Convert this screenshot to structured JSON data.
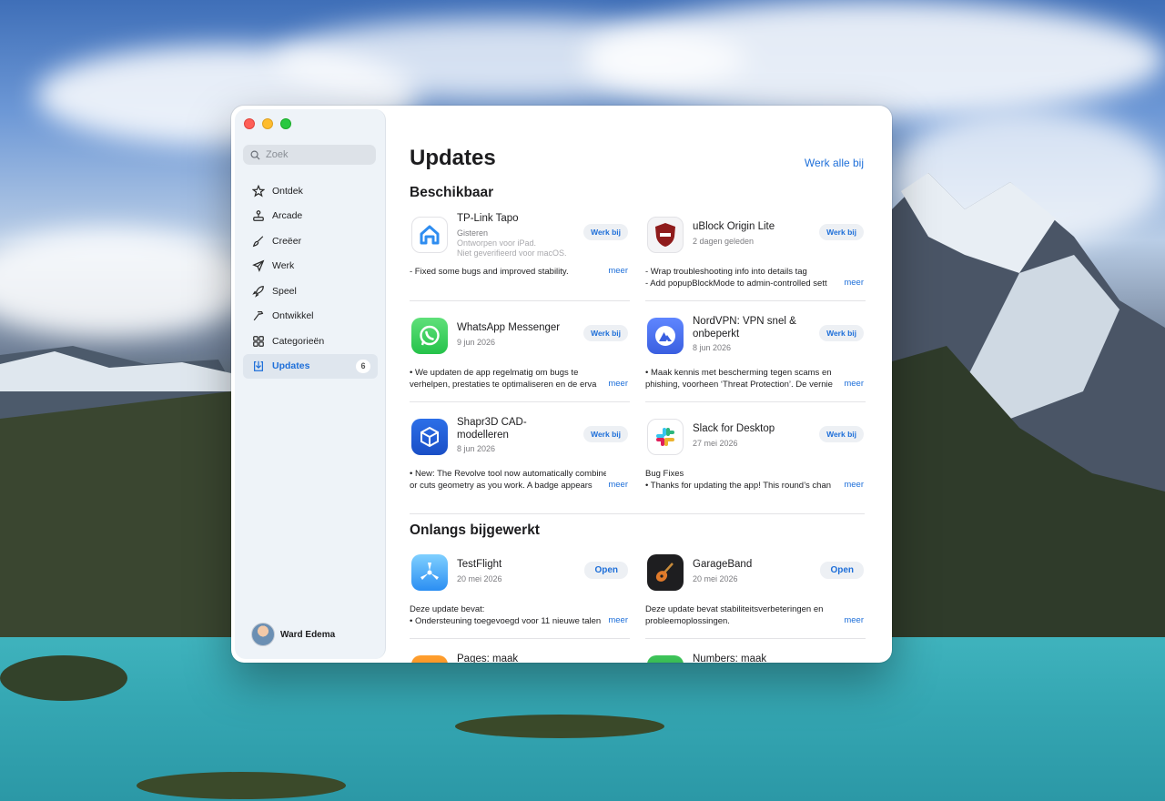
{
  "sidebar": {
    "search_placeholder": "Zoek",
    "items": [
      {
        "label": "Ontdek",
        "icon": "star-icon"
      },
      {
        "label": "Arcade",
        "icon": "joystick-icon"
      },
      {
        "label": "Creëer",
        "icon": "brush-icon"
      },
      {
        "label": "Werk",
        "icon": "paperplane-icon"
      },
      {
        "label": "Speel",
        "icon": "rocket-icon"
      },
      {
        "label": "Ontwikkel",
        "icon": "hammer-icon"
      },
      {
        "label": "Categorieën",
        "icon": "grid-icon"
      },
      {
        "label": "Updates",
        "icon": "download-icon",
        "badge": "6",
        "active": true
      }
    ],
    "user_name": "Ward Edema"
  },
  "main": {
    "title": "Updates",
    "update_all": "Werk alle bij",
    "available_title": "Beschikbaar",
    "recent_title": "Onlangs bijgewerkt",
    "available": [
      {
        "name": "TP-Link Tapo",
        "date": "Gisteren",
        "note1": "Ontworpen voor iPad.",
        "note2": "Niet geverifieerd voor macOS.",
        "button": "Werk bij",
        "line1": "- Fixed some bugs and improved stability.",
        "line2": "",
        "more": "meer"
      },
      {
        "name": "uBlock Origin Lite",
        "date": "2 dagen geleden",
        "button": "Werk bij",
        "line1": "- Wrap troubleshooting info into details tag",
        "line2": "- Add popupBlockMode to admin-controlled sett",
        "more": "meer"
      },
      {
        "name": "WhatsApp Messenger",
        "date": "9 jun 2026",
        "button": "Werk bij",
        "line1": "• We updaten de app regelmatig om bugs te",
        "line2": "verhelpen, prestaties te optimaliseren en de erva",
        "more": "meer"
      },
      {
        "name": "NordVPN: VPN snel & onbeperkt",
        "date": "8 jun 2026",
        "button": "Werk bij",
        "line1": "• Maak kennis met bescherming tegen scams en",
        "line2": "phishing, voorheen ‘Threat Protection’. De vernie",
        "more": "meer"
      },
      {
        "name": "Shapr3D CAD-modelleren",
        "date": "8 jun 2026",
        "button": "Werk bij",
        "line1": "• New: The Revolve tool now automatically combines",
        "line2": "or cuts geometry as you work. A badge appears",
        "more": "meer"
      },
      {
        "name": "Slack for Desktop",
        "date": "27 mei 2026",
        "button": "Werk bij",
        "line1": "Bug Fixes",
        "line2": "• Thanks for updating the app! This round’s chan",
        "more": "meer"
      }
    ],
    "recent": [
      {
        "name": "TestFlight",
        "date": "20 mei 2026",
        "button": "Open",
        "line1": "Deze update bevat:",
        "line2": "• Ondersteuning toegevoegd voor 11 nieuwe talen",
        "more": "meer"
      },
      {
        "name": "GarageBand",
        "date": "20 mei 2026",
        "button": "Open",
        "line1": "Deze update bevat stabiliteitsverbeteringen en",
        "line2": "probleemoplossingen.",
        "more": "meer"
      },
      {
        "name": "Pages: maak",
        "date": "",
        "button": "",
        "line1": "",
        "line2": "",
        "more": ""
      },
      {
        "name": "Numbers: maak",
        "date": "",
        "button": "",
        "line1": "",
        "line2": "",
        "more": ""
      }
    ]
  }
}
